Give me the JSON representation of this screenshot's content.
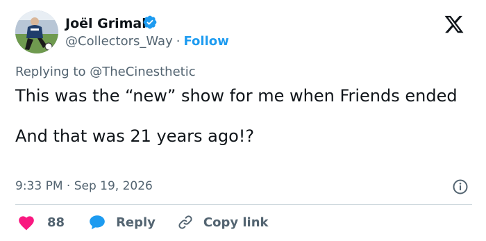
{
  "author": {
    "name": "Joël Grimal",
    "handle": "@Collectors_Way",
    "separator": "·",
    "follow_label": "Follow"
  },
  "reply_context": {
    "prefix": "Replying to",
    "handle": "@TheCinesthetic"
  },
  "tweet": {
    "paragraph_1": "This was the “new” show for me when Friends ended",
    "paragraph_2": "And that was 21 years ago!?"
  },
  "timestamp": {
    "time": "9:33 PM",
    "separator": "·",
    "date": "Sep 19, 2026"
  },
  "actions": {
    "like_count": "88",
    "reply_label": "Reply",
    "copy_link_label": "Copy link"
  },
  "colors": {
    "like": "#f91880",
    "reply": "#1d9bf0",
    "follow": "#1d9bf0",
    "verified": "#1d9bf0",
    "muted": "#536471"
  },
  "icons": [
    "verified-badge-icon",
    "x-logo-icon",
    "info-icon",
    "heart-icon",
    "reply-bubble-icon",
    "link-icon"
  ]
}
